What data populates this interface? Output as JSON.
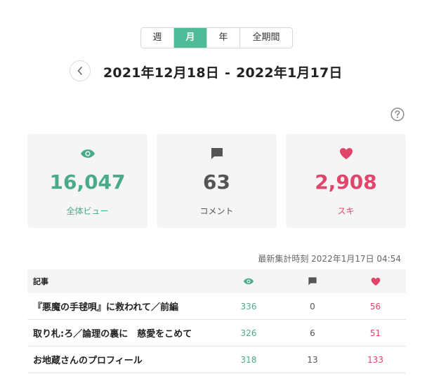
{
  "tabs": [
    {
      "label": "週",
      "active": false
    },
    {
      "label": "月",
      "active": true
    },
    {
      "label": "年",
      "active": false
    },
    {
      "label": "全期間",
      "active": false
    }
  ],
  "date_range": {
    "start": "2021年12月18日",
    "separator": "-",
    "end": "2022年1月17日"
  },
  "stats": {
    "views": {
      "value": "16,047",
      "label": "全体ビュー",
      "icon": "eye-icon"
    },
    "comments": {
      "value": "63",
      "label": "コメント",
      "icon": "comment-icon"
    },
    "likes": {
      "value": "2,908",
      "label": "スキ",
      "icon": "heart-icon"
    }
  },
  "updated_text": "最新集計時刻 2022年1月17日 04:54",
  "table": {
    "header_title": "記事",
    "rows": [
      {
        "title": "『悪魔の手毬唄』に救われて／前編",
        "views": "336",
        "comments": "0",
        "likes": "56"
      },
      {
        "title": "取り札:ろ／論理の裏に　慈愛をこめて",
        "views": "326",
        "comments": "6",
        "likes": "51"
      },
      {
        "title": "お地蔵さんのプロフィール",
        "views": "318",
        "comments": "13",
        "likes": "133"
      }
    ]
  },
  "colors": {
    "accent_green": "#4fbb98",
    "views_green": "#4aab8c",
    "likes_red": "#e0456a",
    "comment_gray": "#555555",
    "card_bg": "#f5f5f5"
  }
}
